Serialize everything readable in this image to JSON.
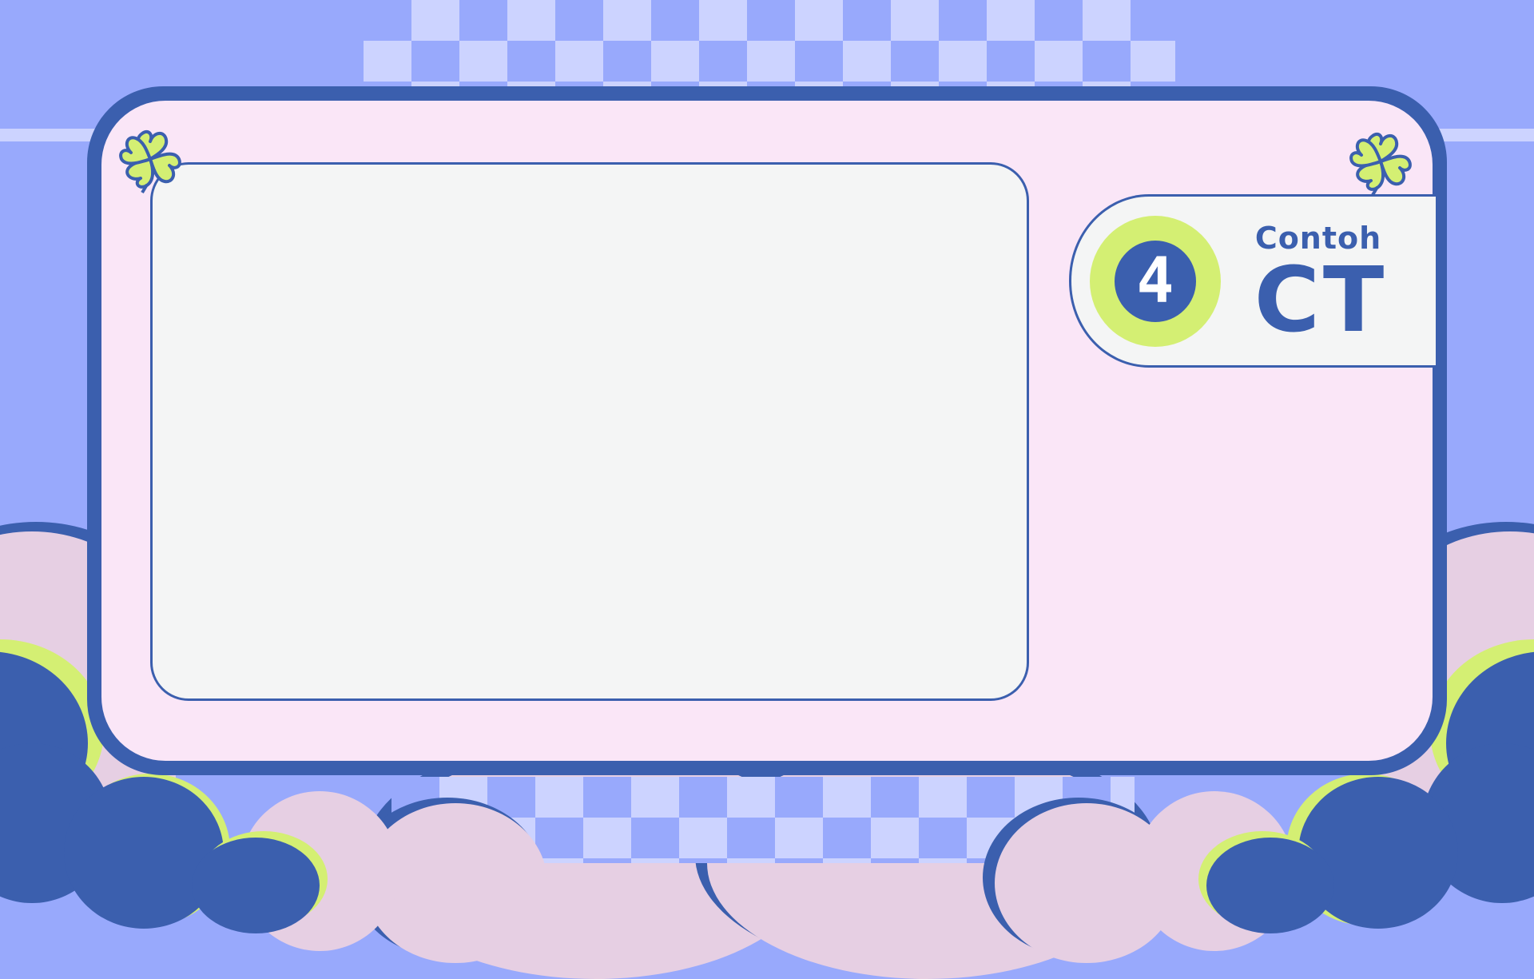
{
  "label": {
    "number": "4",
    "small_text": "Contoh",
    "big_text": "CT"
  },
  "icons": {
    "left_flower": "clover-icon",
    "right_flower": "clover-icon"
  },
  "colors": {
    "background": "#98a9fc",
    "checker_light": "#ccd3ff",
    "frame": "#3b5fae",
    "panel": "#fae6f7",
    "content": "#f4f5f5",
    "accent": "#d4ef73",
    "cloud_pink": "#e6cfe3"
  }
}
